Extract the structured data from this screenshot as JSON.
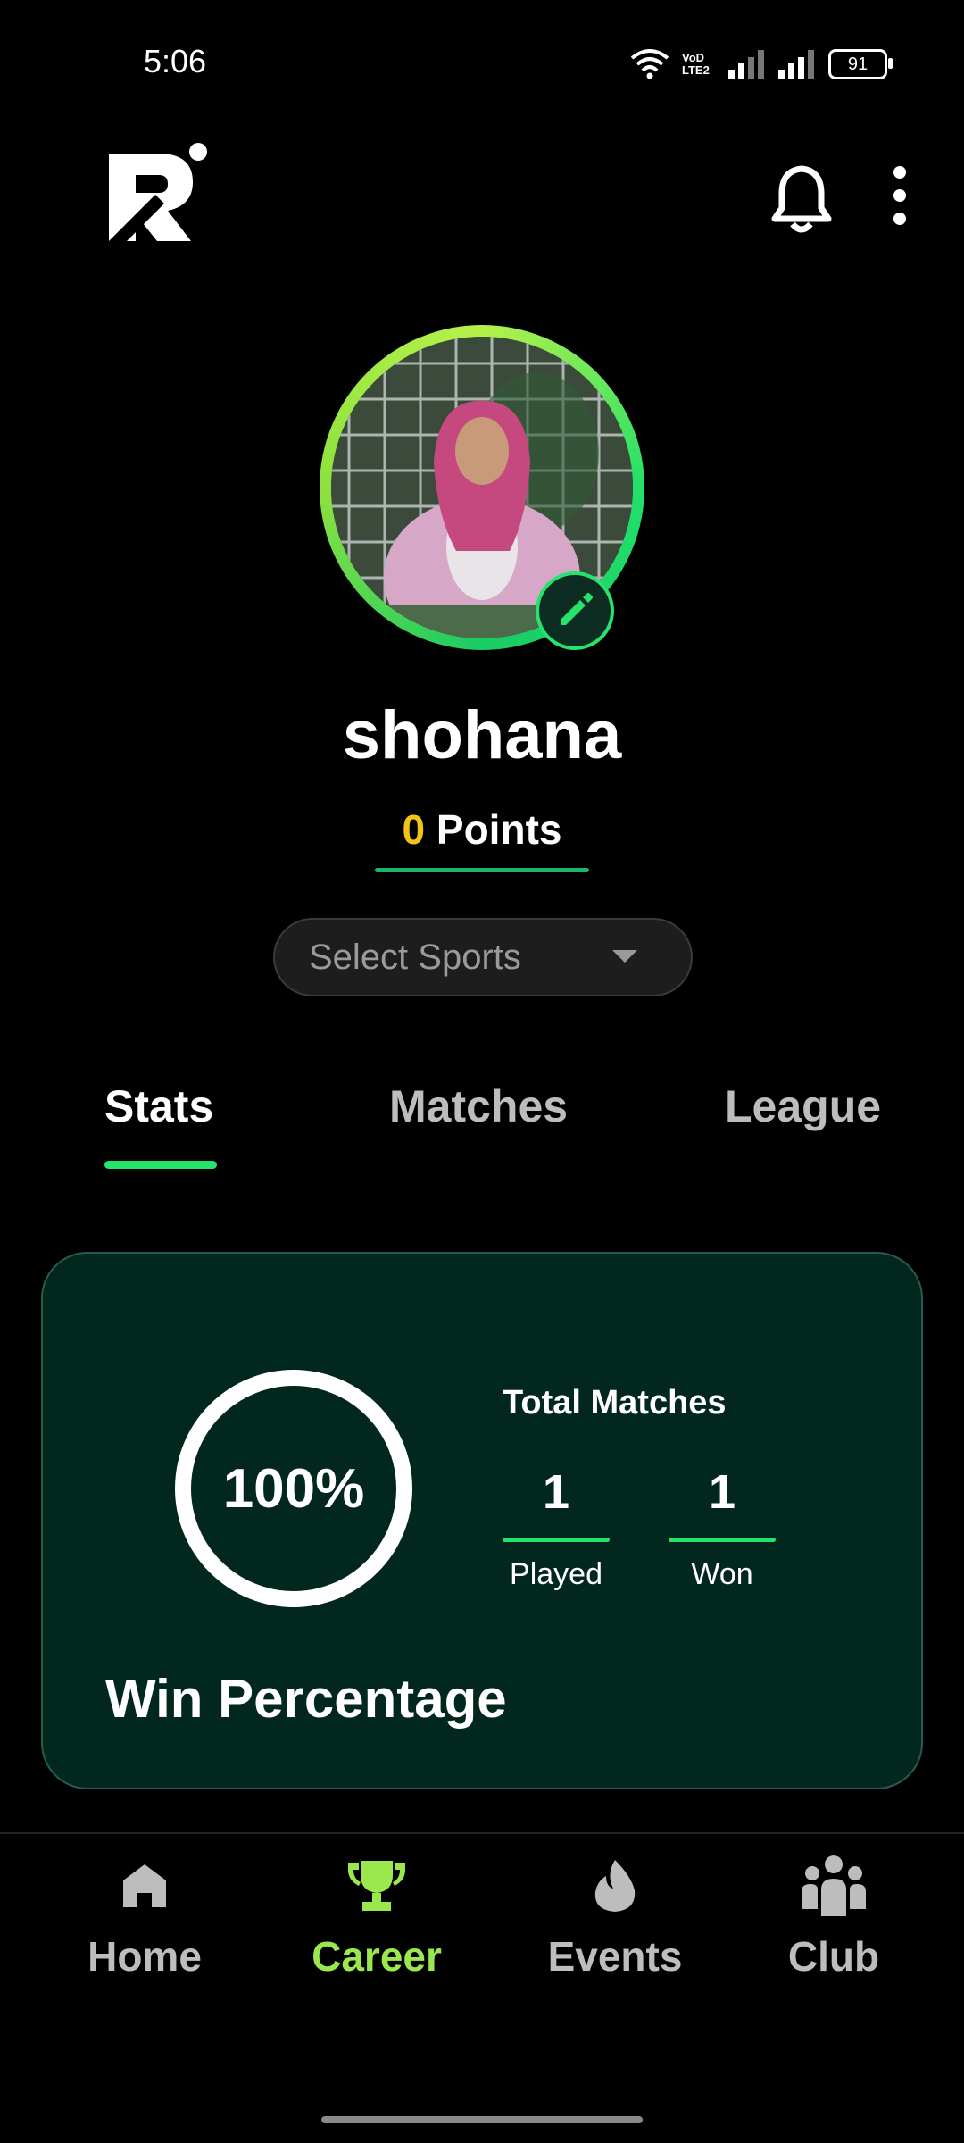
{
  "status_bar": {
    "time": "5:06",
    "network_label": "VoD LTE2",
    "battery": "91"
  },
  "header": {
    "logo_icon": "app-logo",
    "bell_icon": "bell-icon",
    "more_icon": "more-vertical-icon"
  },
  "profile": {
    "username": "shohana",
    "points_value": "0",
    "points_label": "Points",
    "edit_icon": "pencil-icon"
  },
  "sports_select": {
    "placeholder": "Select Sports"
  },
  "tabs": [
    {
      "label": "Stats",
      "active": true
    },
    {
      "label": "Matches",
      "active": false
    },
    {
      "label": "League",
      "active": false
    }
  ],
  "stats_card": {
    "win_percentage_value": "100%",
    "win_percentage": 1.0,
    "win_label": "Win Percentage",
    "total_matches_title": "Total Matches",
    "played_value": "1",
    "played_label": "Played",
    "won_value": "1",
    "won_label": "Won"
  },
  "bottom_nav": [
    {
      "label": "Home",
      "icon": "home-icon",
      "active": false
    },
    {
      "label": "Career",
      "icon": "trophy-icon",
      "active": true
    },
    {
      "label": "Events",
      "icon": "flame-icon",
      "active": false
    },
    {
      "label": "Club",
      "icon": "group-icon",
      "active": false
    }
  ],
  "colors": {
    "accent_green": "#27e36c",
    "points_yellow": "#f2c417",
    "active_nav": "#9be84e",
    "card_bg": "#02271e"
  }
}
